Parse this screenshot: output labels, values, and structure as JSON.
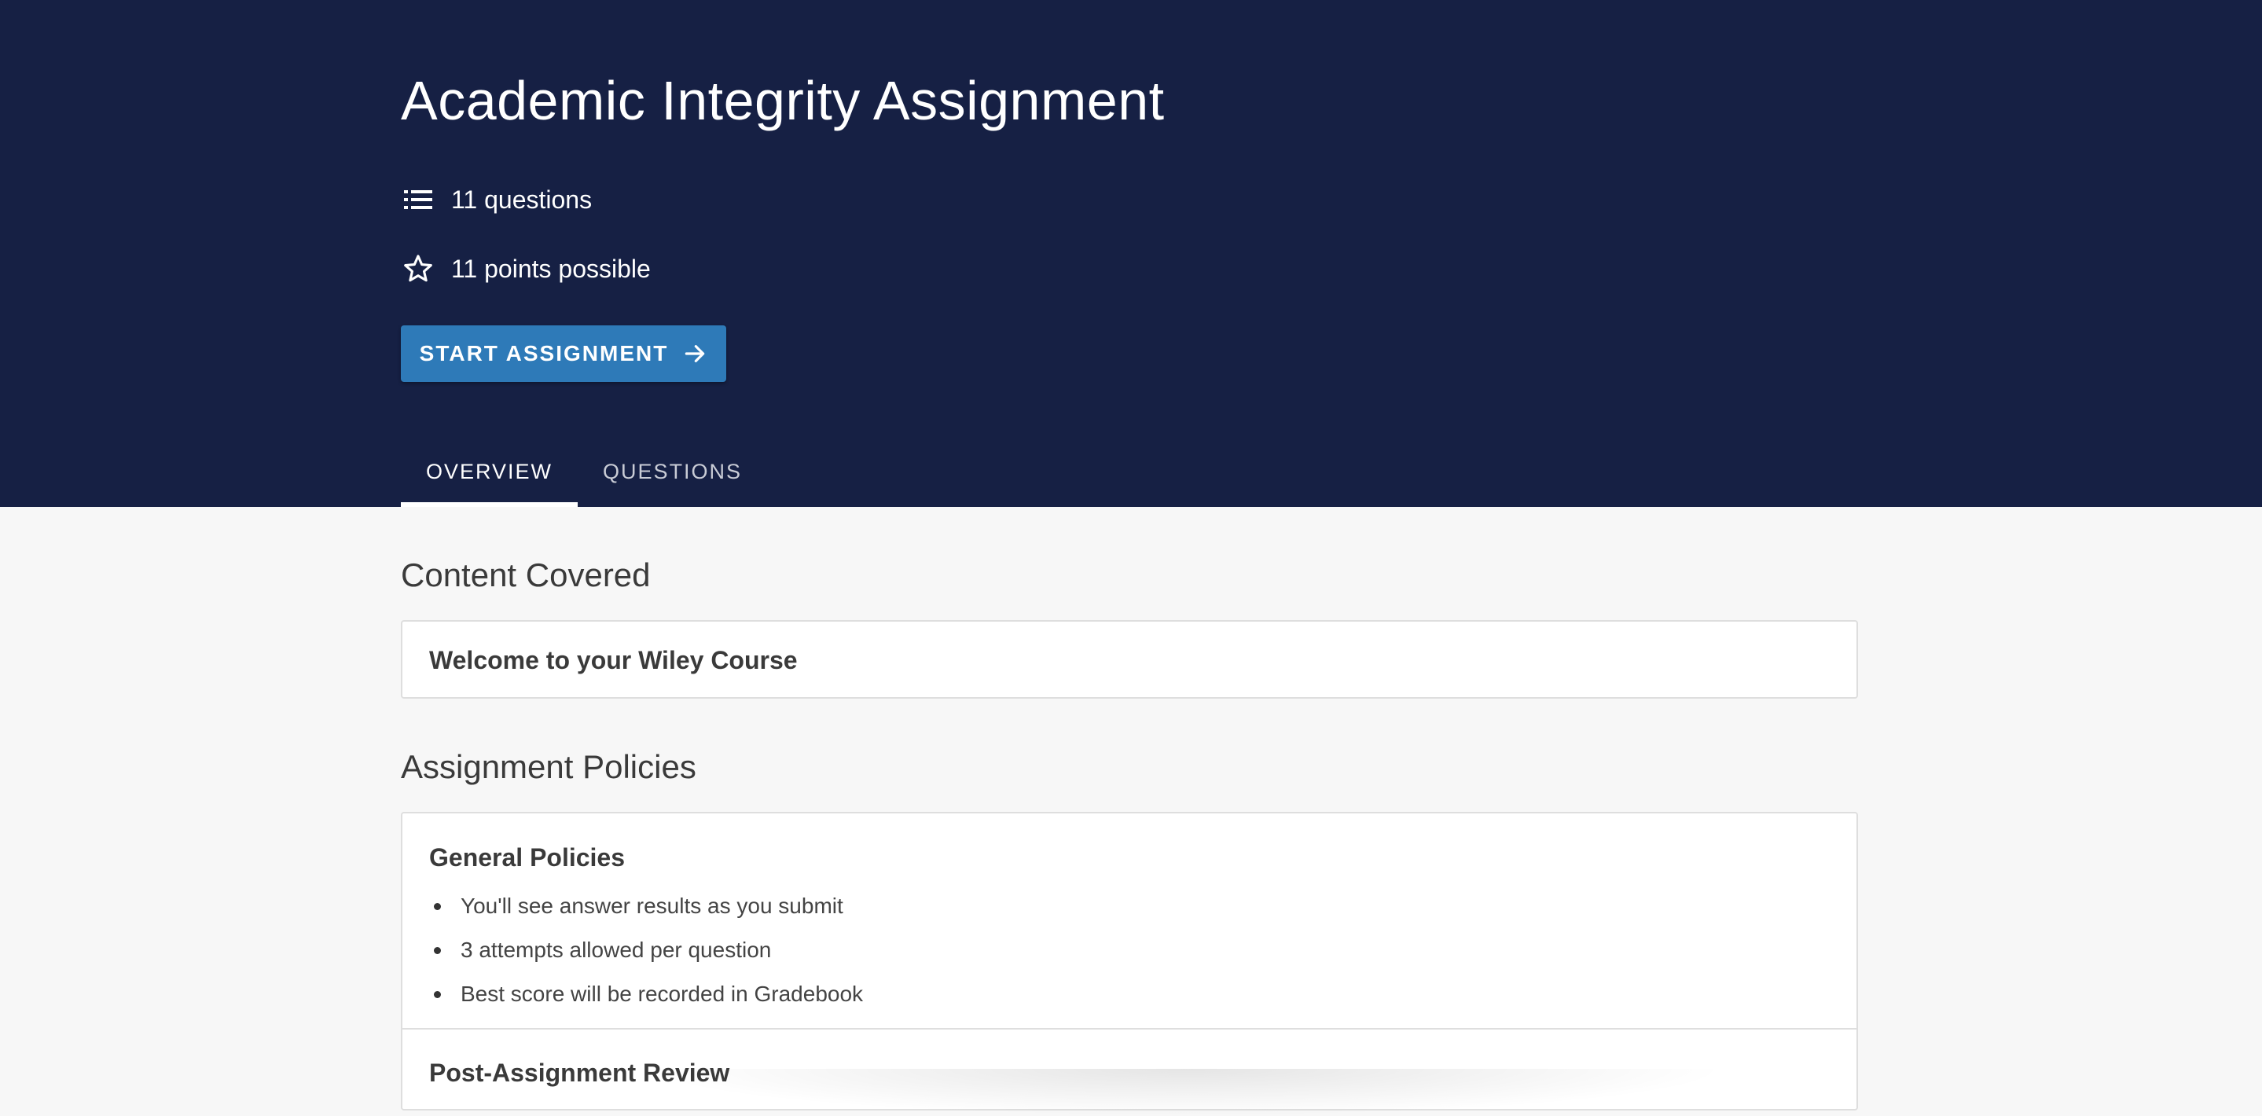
{
  "assignment": {
    "title": "Academic Integrity Assignment",
    "questions_count": "11 questions",
    "points": "11 points possible",
    "start_label": "START ASSIGNMENT"
  },
  "tabs": [
    {
      "label": "OVERVIEW",
      "active": true
    },
    {
      "label": "QUESTIONS",
      "active": false
    }
  ],
  "content_covered": {
    "heading": "Content Covered",
    "item": "Welcome to your Wiley Course"
  },
  "policies": {
    "heading": "Assignment Policies",
    "general": {
      "title": "General Policies",
      "items": [
        "You'll see answer results as you submit",
        "3 attempts allowed per question",
        "Best score will be recorded in Gradebook"
      ]
    },
    "post_review": {
      "title": "Post-Assignment Review"
    }
  },
  "colors": {
    "header_bg": "#162044",
    "button_bg": "#2e7ab8",
    "page_bg": "#f7f7f7"
  },
  "icons": {
    "questions": "list-icon",
    "points": "star-outline-icon",
    "start": "arrow-right-icon"
  }
}
